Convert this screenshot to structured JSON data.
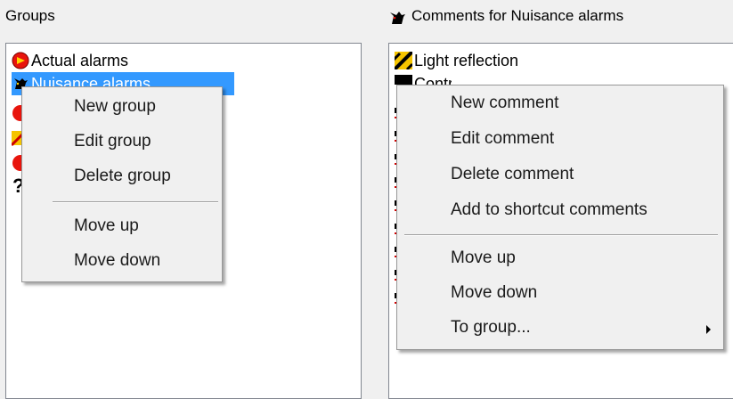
{
  "groups_panel": {
    "label": "Groups",
    "items": [
      {
        "label": "Actual alarms",
        "icon": "red-alarm-icon"
      },
      {
        "label": "Nuisance alarms",
        "icon": "black-cat-icon",
        "selected": true
      }
    ]
  },
  "comments_panel": {
    "label": "Comments for Nuisance alarms",
    "items": [
      {
        "label": "Light reflection",
        "icon": "warning-stripe-icon"
      },
      {
        "label": "Contrast",
        "icon": "black-square-icon"
      }
    ]
  },
  "group_menu": {
    "items": [
      "New group",
      "Edit group",
      "Delete group"
    ],
    "items2": [
      "Move up",
      "Move down"
    ]
  },
  "comment_menu": {
    "items": [
      "New comment",
      "Edit comment",
      "Delete comment",
      "Add to shortcut comments"
    ],
    "items2": [
      "Move up",
      "Move down",
      "To group..."
    ]
  },
  "colors": {
    "selection": "#3399ff",
    "menu_bg": "#f0f0f0",
    "window_bg": "#f0f0f0"
  }
}
